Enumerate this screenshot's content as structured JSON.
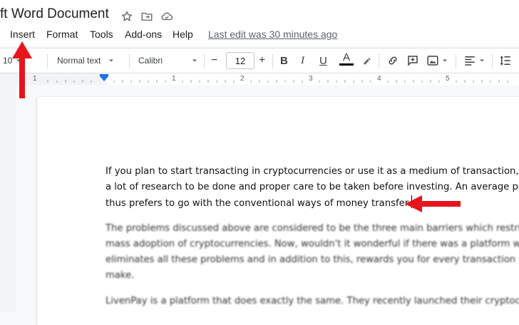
{
  "doc": {
    "title": "ft Word Document"
  },
  "menu": {
    "items": [
      "Insert",
      "Format",
      "Tools",
      "Add-ons",
      "Help"
    ],
    "last_edit": "Last edit was 30 minutes ago"
  },
  "toolbar": {
    "zoom": "10",
    "style": "Normal text",
    "font": "Calibri",
    "font_size": "12"
  },
  "ruler": {
    "marks": [
      "1",
      "1",
      "2",
      "3",
      "4",
      "5"
    ]
  },
  "body": {
    "para1": [
      "If you plan to start transacting in cryptocurrencies or use it as a medium of transaction, th",
      "a lot of research to be done and proper care to be taken before investing. An average pers",
      "thus prefers to go with the conventional ways of money transfer."
    ],
    "para2": [
      "The problems discussed above are considered to be the three main barriers which restrict",
      "mass adoption of cryptocurrencies. Now, wouldn't it wonderful if there was a platform wh",
      "eliminates all these problems and in addition to this, rewards you for every transaction you",
      "make."
    ],
    "para3": [
      "LivenPay is a platform that does exactly the same. They recently launched their cryptocur"
    ]
  },
  "colors": {
    "annotation_arrow": "#e8141b",
    "accent_blue": "#1a73e8"
  },
  "icons": [
    "star-icon",
    "move-to-folder-icon",
    "cloud-status-icon",
    "undo-icon",
    "bold-icon",
    "italic-icon",
    "underline-icon",
    "text-color-icon",
    "highlight-icon",
    "link-icon",
    "comment-icon",
    "image-icon",
    "align-icon",
    "line-spacing-icon"
  ]
}
